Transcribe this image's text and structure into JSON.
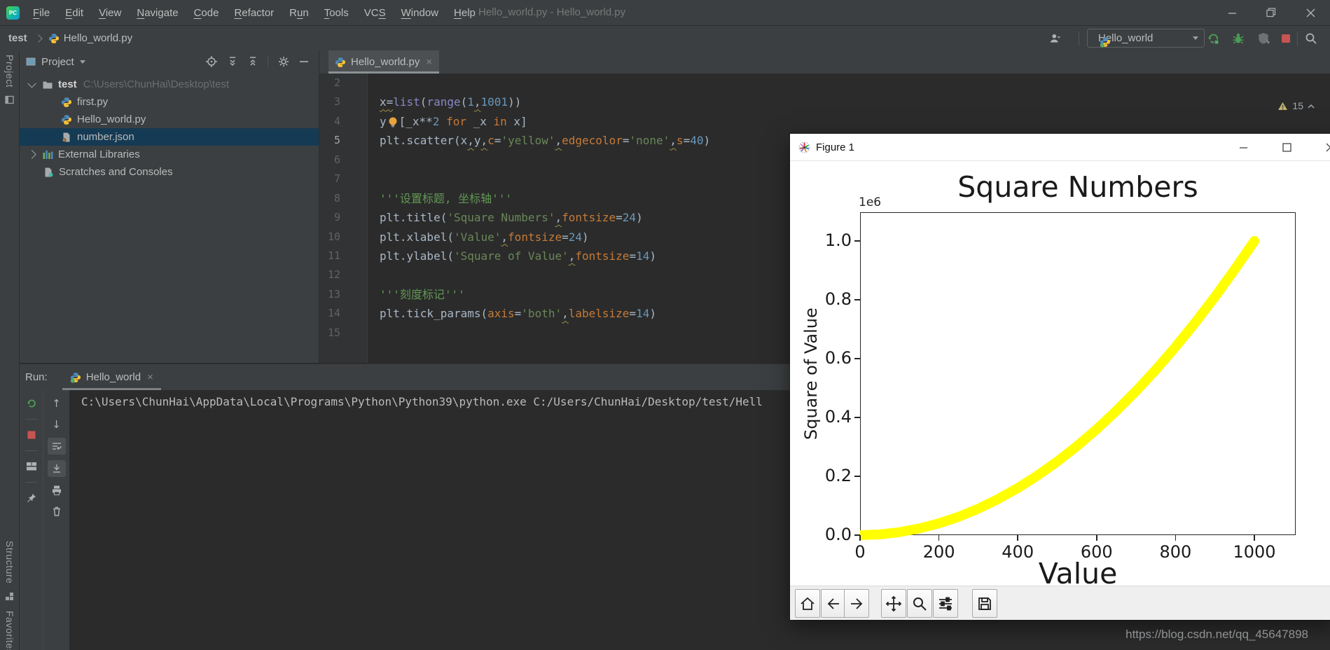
{
  "window": {
    "title": "Hello_world.py - Hello_world.py"
  },
  "menubar": {
    "items": [
      {
        "label": "File",
        "mn": 0
      },
      {
        "label": "Edit",
        "mn": 0
      },
      {
        "label": "View",
        "mn": 0
      },
      {
        "label": "Navigate",
        "mn": 0
      },
      {
        "label": "Code",
        "mn": 0
      },
      {
        "label": "Refactor",
        "mn": 0
      },
      {
        "label": "Run",
        "mn": 1
      },
      {
        "label": "Tools",
        "mn": 0
      },
      {
        "label": "VCS",
        "mn": 2
      },
      {
        "label": "Window",
        "mn": 0
      },
      {
        "label": "Help",
        "mn": 0
      }
    ]
  },
  "navbar": {
    "breadcrumb": {
      "root": "test",
      "file": "Hello_world.py"
    },
    "run_config": "Hello_world"
  },
  "left_bar": {
    "top": "Project",
    "bottom_structure": "Structure",
    "bottom_favorites": "Favorites"
  },
  "project": {
    "header": "Project",
    "tree": [
      {
        "type": "folder",
        "chevron": "open",
        "label": "test",
        "path": "C:\\Users\\ChunHai\\Desktop\\test",
        "level": 0,
        "bold": true,
        "selected": false
      },
      {
        "type": "py",
        "label": "first.py",
        "level": 1,
        "selected": false
      },
      {
        "type": "py",
        "label": "Hello_world.py",
        "level": 1,
        "selected": false
      },
      {
        "type": "json",
        "label": "number.json",
        "level": 1,
        "selected": true
      },
      {
        "type": "lib",
        "chevron": "closed",
        "label": "External Libraries",
        "level": 0,
        "selected": false
      },
      {
        "type": "scratch",
        "label": "Scratches and Consoles",
        "level": 0,
        "selected": false
      }
    ]
  },
  "editor": {
    "tab": "Hello_world.py",
    "warning_count": "15",
    "lines": [
      {
        "n": 2,
        "tokens": []
      },
      {
        "n": 3,
        "tokens": [
          {
            "t": "x=",
            "c": "d q"
          },
          {
            "t": "list",
            "c": "b"
          },
          {
            "t": "(",
            "c": "d"
          },
          {
            "t": "range",
            "c": "b"
          },
          {
            "t": "(",
            "c": "d"
          },
          {
            "t": "1",
            "c": "n"
          },
          {
            "t": ",",
            "c": "d q"
          },
          {
            "t": "1001",
            "c": "n"
          },
          {
            "t": "))",
            "c": "d"
          }
        ]
      },
      {
        "n": 4,
        "tokens": [
          {
            "t": "y",
            "c": "d"
          },
          {
            "bulb": true
          },
          {
            "t": "[_x**",
            "c": "d"
          },
          {
            "t": "2",
            "c": "n"
          },
          {
            "t": " ",
            "c": "d"
          },
          {
            "t": "for",
            "c": "k"
          },
          {
            "t": " _x ",
            "c": "d"
          },
          {
            "t": "in",
            "c": "k"
          },
          {
            "t": " x]",
            "c": "d"
          }
        ]
      },
      {
        "n": 5,
        "cur": true,
        "tokens": [
          {
            "t": "plt.scatter(x",
            "c": "d"
          },
          {
            "t": ",",
            "c": "d q"
          },
          {
            "t": "y",
            "c": "d"
          },
          {
            "t": ",",
            "c": "d q"
          },
          {
            "t": "c",
            "c": "p"
          },
          {
            "t": "=",
            "c": "d"
          },
          {
            "t": "'yellow'",
            "c": "s"
          },
          {
            "t": ",",
            "c": "d q"
          },
          {
            "t": "edgecolor",
            "c": "p"
          },
          {
            "t": "=",
            "c": "d"
          },
          {
            "t": "'none'",
            "c": "s"
          },
          {
            "t": ",",
            "c": "d q"
          },
          {
            "t": "s",
            "c": "p"
          },
          {
            "t": "=",
            "c": "d"
          },
          {
            "t": "40",
            "c": "n"
          },
          {
            "t": ")",
            "c": "d"
          }
        ]
      },
      {
        "n": 6,
        "tokens": []
      },
      {
        "n": 7,
        "tokens": []
      },
      {
        "n": 8,
        "tokens": [
          {
            "t": "'''设置标题, 坐标轴'''",
            "c": "c"
          }
        ]
      },
      {
        "n": 9,
        "tokens": [
          {
            "t": "plt.title(",
            "c": "d"
          },
          {
            "t": "'Square Numbers'",
            "c": "s"
          },
          {
            "t": ",",
            "c": "d q"
          },
          {
            "t": "fontsize",
            "c": "p"
          },
          {
            "t": "=",
            "c": "d"
          },
          {
            "t": "24",
            "c": "n"
          },
          {
            "t": ")",
            "c": "d"
          }
        ]
      },
      {
        "n": 10,
        "tokens": [
          {
            "t": "plt.xlabel(",
            "c": "d"
          },
          {
            "t": "'Value'",
            "c": "s"
          },
          {
            "t": ",",
            "c": "d q"
          },
          {
            "t": "fontsize",
            "c": "p"
          },
          {
            "t": "=",
            "c": "d"
          },
          {
            "t": "24",
            "c": "n"
          },
          {
            "t": ")",
            "c": "d"
          }
        ]
      },
      {
        "n": 11,
        "tokens": [
          {
            "t": "plt.ylabel(",
            "c": "d"
          },
          {
            "t": "'Square of Value'",
            "c": "s"
          },
          {
            "t": ",",
            "c": "d q"
          },
          {
            "t": "fontsize",
            "c": "p"
          },
          {
            "t": "=",
            "c": "d"
          },
          {
            "t": "14",
            "c": "n"
          },
          {
            "t": ")",
            "c": "d"
          }
        ]
      },
      {
        "n": 12,
        "tokens": []
      },
      {
        "n": 13,
        "tokens": [
          {
            "t": "'''刻度标记'''",
            "c": "c"
          }
        ]
      },
      {
        "n": 14,
        "tokens": [
          {
            "t": "plt.tick_params(",
            "c": "d"
          },
          {
            "t": "axis",
            "c": "p"
          },
          {
            "t": "=",
            "c": "d"
          },
          {
            "t": "'both'",
            "c": "s"
          },
          {
            "t": ",",
            "c": "d q"
          },
          {
            "t": "labelsize",
            "c": "p"
          },
          {
            "t": "=",
            "c": "d"
          },
          {
            "t": "14",
            "c": "n"
          },
          {
            "t": ")",
            "c": "d"
          }
        ]
      },
      {
        "n": 15,
        "tokens": []
      }
    ]
  },
  "run_panel": {
    "label": "Run:",
    "tab": "Hello_world",
    "console_line": "C:\\Users\\ChunHai\\AppData\\Local\\Programs\\Python\\Python39\\python.exe C:/Users/ChunHai/Desktop/test/Hell"
  },
  "figure": {
    "window_title": "Figure 1"
  },
  "chart_data": {
    "type": "scatter",
    "title": "Square Numbers",
    "xlabel": "Value",
    "ylabel": "Square of Value",
    "y_offset_text": "1e6",
    "marker_color": "#FFFF00",
    "marker_size": 40,
    "x_range": [
      1,
      1000
    ],
    "formula": "y = x^2",
    "points_x": [
      0,
      50,
      100,
      150,
      200,
      250,
      300,
      350,
      400,
      450,
      500,
      550,
      600,
      650,
      700,
      750,
      800,
      850,
      900,
      950,
      1000
    ],
    "points_y": [
      0,
      2500,
      10000,
      22500,
      40000,
      62500,
      90000,
      122500,
      160000,
      202500,
      250000,
      302500,
      360000,
      422500,
      490000,
      562500,
      640000,
      722500,
      810000,
      902500,
      1000000
    ],
    "xticks": [
      0,
      200,
      400,
      600,
      800,
      1000
    ],
    "xtick_labels": [
      "0",
      "200",
      "400",
      "600",
      "800",
      "1000"
    ],
    "yticks": [
      0,
      0.2,
      0.4,
      0.6,
      0.8,
      1.0
    ],
    "ytick_labels": [
      "0.0",
      "0.2",
      "0.4",
      "0.6",
      "0.8",
      "1.0"
    ],
    "xlim": [
      0,
      1105
    ],
    "ylim": [
      0,
      1098000
    ],
    "grid": false,
    "legend": null
  },
  "watermark": "https://blog.csdn.net/qq_45647898"
}
